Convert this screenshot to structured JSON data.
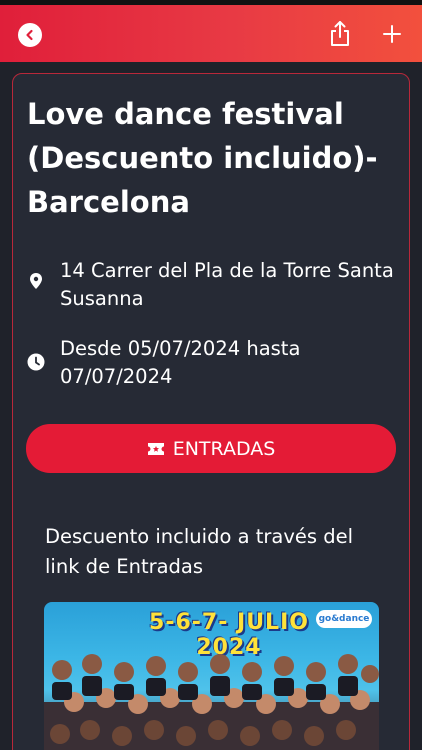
{
  "header": {
    "back_icon": "chevron-left-icon",
    "share_icon": "share-icon",
    "add_icon": "plus-icon",
    "gradient_colors": [
      "#e01f3a",
      "#f2503d"
    ]
  },
  "event": {
    "title": "Love dance festival (Descuento incluido)-Barcelona",
    "address": "14 Carrer del Pla de la Torre Santa Susanna",
    "dates": "Desde 05/07/2024 hasta 07/07/2024",
    "tickets_label": "ENTRADAS",
    "description": "Descuento incluido a través del link de Entradas"
  },
  "poster": {
    "headline": "5-6-7- JULIO 2024",
    "logo_text": "go&dance"
  },
  "colors": {
    "accent": "#e41b36",
    "background": "#1f222a",
    "card": "#262a35",
    "card_border": "#b8283a"
  }
}
